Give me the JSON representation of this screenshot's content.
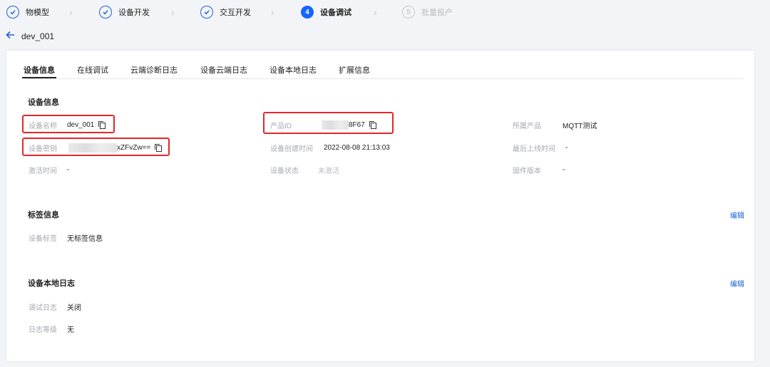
{
  "steps": [
    {
      "num": "",
      "label": "物模型",
      "state": "done"
    },
    {
      "num": "",
      "label": "设备开发",
      "state": "done"
    },
    {
      "num": "",
      "label": "交互开发",
      "state": "done"
    },
    {
      "num": "4",
      "label": "设备调试",
      "state": "active"
    },
    {
      "num": "5",
      "label": "批量投产",
      "state": "todo"
    }
  ],
  "device_title": "dev_001",
  "tabs": [
    "设备信息",
    "在线调试",
    "云端诊断日志",
    "设备云端日志",
    "设备本地日志",
    "扩展信息"
  ],
  "device_info": {
    "title": "设备信息",
    "name_label": "设备名称",
    "name_value": "dev_001",
    "product_id_label": "产品ID",
    "product_id_value": "8F67",
    "product_label": "所属产品",
    "product_value": "MQTT测试",
    "secret_label": "设备密钥",
    "secret_value": "xZFvZw==",
    "created_label": "设备创建时间",
    "created_value": "2022-08-08 21:13:03",
    "last_online_label": "最后上线时间",
    "last_online_value": "-",
    "activated_label": "激活时间",
    "activated_value": "-",
    "status_label": "设备状态",
    "status_value": "未激活",
    "firmware_label": "固件版本",
    "firmware_value": "-"
  },
  "tag_info": {
    "title": "标签信息",
    "edit": "编辑",
    "tag_label": "设备标签",
    "tag_value": "无标签信息"
  },
  "local_log": {
    "title": "设备本地日志",
    "edit": "编辑",
    "debug_label": "调试日志",
    "debug_value": "关闭",
    "level_label": "日志等级",
    "level_value": "无"
  }
}
